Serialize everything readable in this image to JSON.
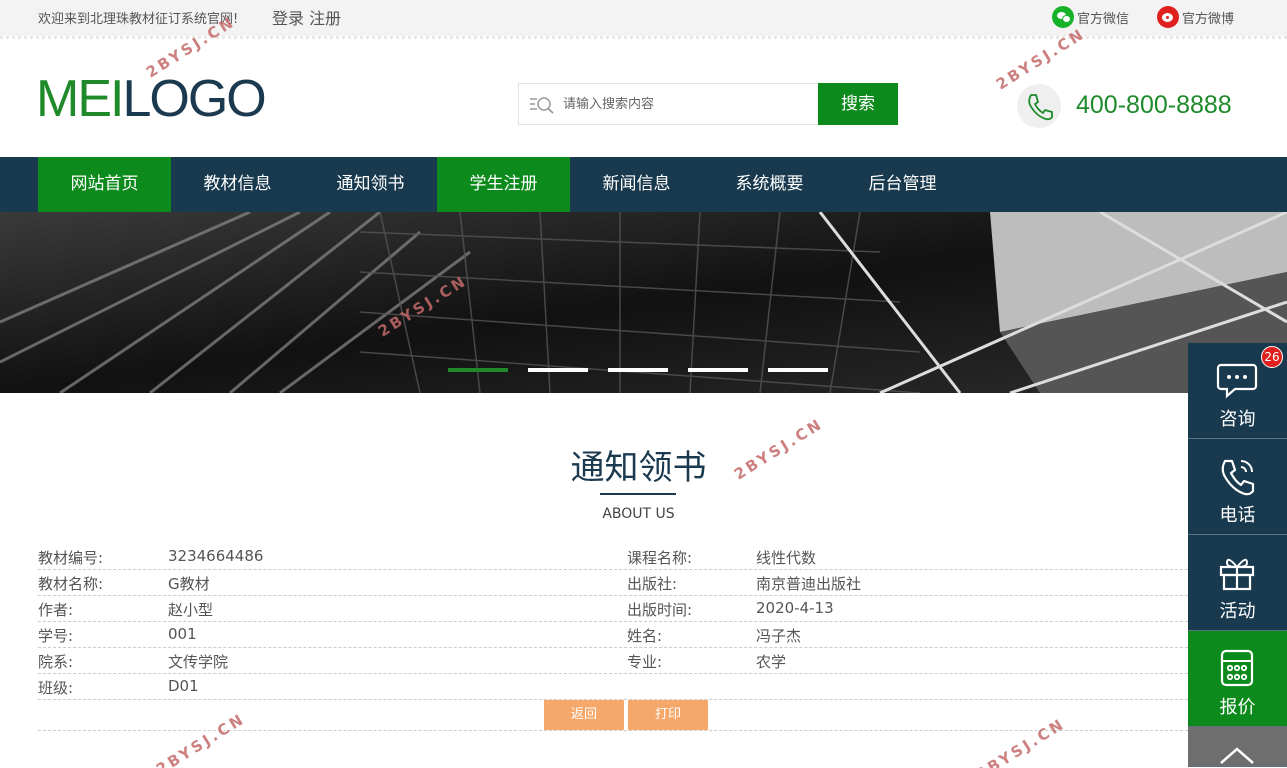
{
  "topbar": {
    "welcome": "欢迎来到北理珠教材征订系统官网!",
    "login": "登录",
    "register": "注册",
    "wechat": "官方微信",
    "weibo": "官方微博"
  },
  "header": {
    "logo_part1": "MEI",
    "logo_part2": "LOGO",
    "search_placeholder": "请输入搜索内容",
    "search_button": "搜索",
    "phone": "400-800-8888"
  },
  "nav": {
    "items": [
      "网站首页",
      "教材信息",
      "通知领书",
      "学生注册",
      "新闻信息",
      "系统概要",
      "后台管理"
    ]
  },
  "section": {
    "title": "通知领书",
    "subtitle": "ABOUT US"
  },
  "detail": {
    "rows": [
      {
        "l1": "教材编号:",
        "v1": "3234664486",
        "l2": "课程名称:",
        "v2": "线性代数"
      },
      {
        "l1": "教材名称:",
        "v1": "G教材",
        "l2": "出版社:",
        "v2": "南京普迪出版社"
      },
      {
        "l1": "作者:",
        "v1": "赵小型",
        "l2": "出版时间:",
        "v2": "2020-4-13"
      },
      {
        "l1": "学号:",
        "v1": "001",
        "l2": "姓名:",
        "v2": "冯子杰"
      },
      {
        "l1": "院系:",
        "v1": "文传学院",
        "l2": "专业:",
        "v2": "农学"
      },
      {
        "l1": "班级:",
        "v1": "D01",
        "l2": "",
        "v2": ""
      }
    ],
    "back_button": "返回",
    "print_button": "打印"
  },
  "float": {
    "consult": "咨询",
    "consult_badge": "26",
    "phone": "电话",
    "activity": "活动",
    "quote": "报价"
  },
  "watermark": "2BYSJ.CN",
  "colors": {
    "brand_green": "#0d8a1c",
    "nav_navy": "#193a4e",
    "button_orange": "#f6a76a"
  }
}
